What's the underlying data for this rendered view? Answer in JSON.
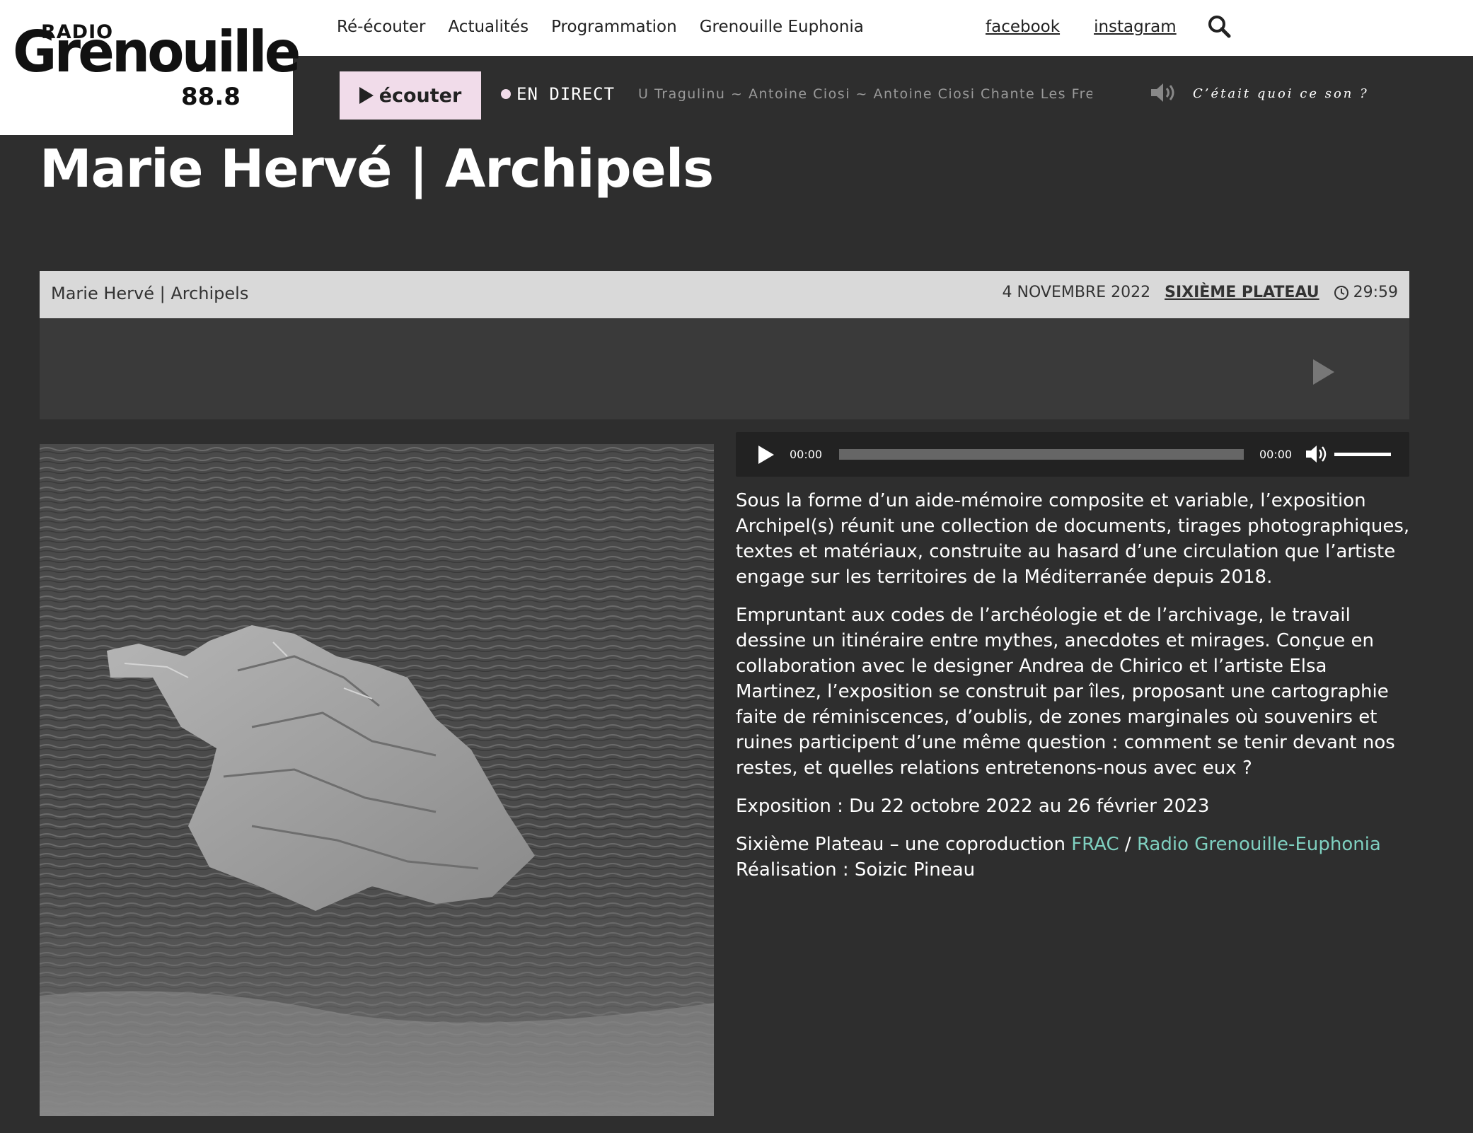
{
  "logo": {
    "radio": "RADIO",
    "name": "Grenouille",
    "frequency": "88.8"
  },
  "nav": {
    "items": [
      "Ré-écouter",
      "Actualités",
      "Programmation",
      "Grenouille Euphonia"
    ],
    "social": [
      "facebook",
      "instagram"
    ]
  },
  "player": {
    "listen_label": "écouter",
    "live_label": "EN DIRECT",
    "now_playing": "U Tragulinu ~ Antoine Ciosi ~ Antoine Ciosi Chante Les Fre`",
    "question": "C’était quoi ce son ?"
  },
  "page": {
    "title": "Marie Hervé | Archipels"
  },
  "episode": {
    "title": "Marie Hervé | Archipels",
    "date": "4 NOVEMBRE 2022",
    "show": "SIXIÈME PLATEAU",
    "duration": "29:59"
  },
  "audio": {
    "current": "00:00",
    "total": "00:00",
    "progress": 0,
    "volume": 1
  },
  "description": {
    "p1": "Sous la forme d’un aide-mémoire composite et variable, l’exposition Archipel(s) réunit une collection de documents, tirages photographiques, textes et matériaux, construite au hasard d’une circulation que l’artiste engage sur les territoires de la Méditerranée depuis 2018.",
    "p2": "Empruntant aux codes de l’archéologie et de l’archivage, le travail dessine un itinéraire entre mythes, anecdotes et mirages. Conçue en collaboration avec le designer Andrea de Chirico et l’artiste Elsa Martinez, l’exposition se construit par îles, proposant une cartographie faite de réminiscences, d’oublis, de zones marginales où souvenirs et ruines participent d’une même question : comment se tenir devant nos restes, et quelles relations entretenons-nous avec eux ?",
    "p3": "Exposition : Du 22 octobre 2022 au 26 février 2023",
    "p4_prefix": "Sixième Plateau – une coproduction ",
    "link1": "FRAC",
    "separator": " / ",
    "link2": "Radio Grenouille-Euphonia",
    "p4_credit": "Réalisation : Soizic Pineau"
  },
  "colors": {
    "background": "#2e2e2e",
    "accent_pink": "#f1dcea",
    "link": "#7fd0c0",
    "header_grey": "#d9d9d9"
  }
}
